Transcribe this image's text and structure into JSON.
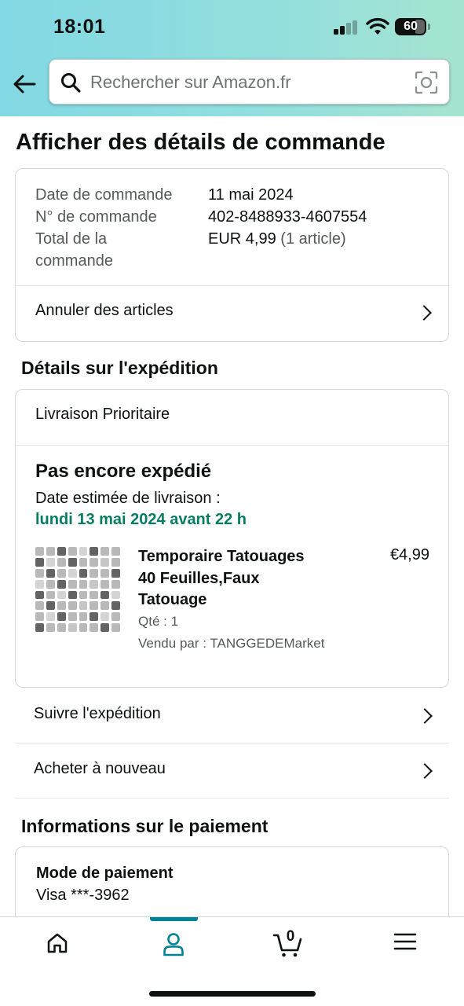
{
  "status_bar": {
    "time": "18:01",
    "battery": "60"
  },
  "search": {
    "placeholder": "Rechercher sur Amazon.fr"
  },
  "page_title": "Afficher des détails de commande",
  "order_summary": {
    "rows": [
      {
        "label": "Date de commande",
        "value": "11 mai 2024"
      },
      {
        "label": "N° de commande",
        "value": "402-8488933-4607554"
      },
      {
        "label_line1": "Total de la",
        "label_line2": "commande",
        "value": "EUR 4,99",
        "value_extra": "(1 article)"
      }
    ],
    "cancel_link": "Annuler des articles"
  },
  "shipping": {
    "section_title": "Détails sur l'expédition",
    "method": "Livraison Prioritaire",
    "status": "Pas encore expédié",
    "estimate_label": "Date estimée de livraison :",
    "estimate_date": "lundi 13 mai 2024 avant 22 h",
    "product": {
      "title_line1": "Temporaire Tatouages",
      "title_line2": "40 Feuilles,Faux",
      "title_line3": "Tatouage",
      "price": "€4,99",
      "qty": "Qté : 1",
      "seller": "Vendu par : TANGGEDEMarket"
    }
  },
  "actions": {
    "track": "Suivre l'expédition",
    "buy_again": "Acheter à nouveau"
  },
  "payment": {
    "section_title": "Informations sur le paiement",
    "method_label": "Mode de paiement",
    "method_value": "Visa ***-3962"
  },
  "tabbar": {
    "items": [
      "home-icon",
      "account-icon",
      "cart-icon",
      "menu-icon"
    ],
    "cart_count": "0",
    "active_color": "#008296"
  }
}
